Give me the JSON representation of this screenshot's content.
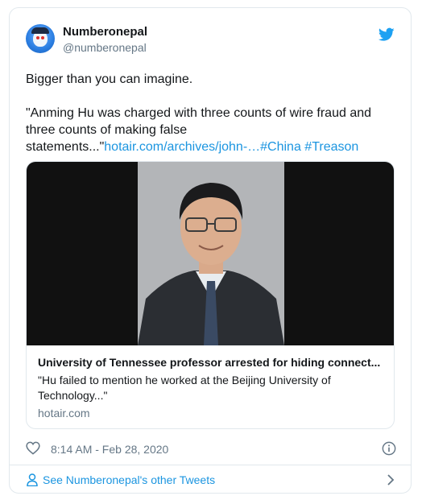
{
  "author": {
    "display_name": "Numberonepal",
    "handle": "@numberonepal"
  },
  "tweet": {
    "line1": "Bigger than you can imagine.",
    "quote": "\"Anming Hu was charged with three counts of wire fraud and three counts of making false statements...\"",
    "link_text": "hotair.com/archives/john-…",
    "hashtags": [
      "#China",
      "#Treason"
    ]
  },
  "link_card": {
    "title": "University of Tennessee professor arrested for hiding connect...",
    "description": "\"Hu failed to mention he worked at the Beijing University of Technology...\"",
    "domain": "hotair.com"
  },
  "meta": {
    "timestamp": "8:14 AM - Feb 28, 2020"
  },
  "footer": {
    "label": "See Numberonepal's other Tweets"
  },
  "colors": {
    "link": "#1b95e0",
    "secondary_text": "#657786",
    "border": "#e1e8ed"
  },
  "icons": [
    "twitter-bird-icon",
    "heart-icon",
    "info-icon",
    "person-icon",
    "chevron-right-icon"
  ]
}
